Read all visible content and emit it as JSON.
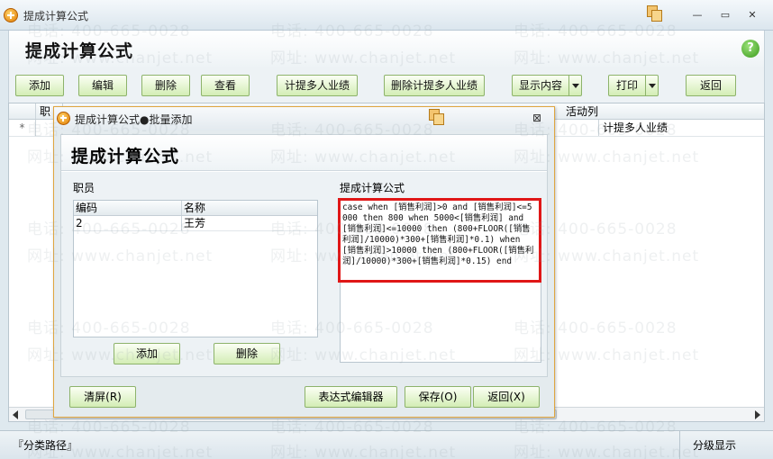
{
  "window": {
    "title": "提成计算公式"
  },
  "window_controls": {
    "minimize": "—",
    "restore": "▭",
    "close": "✕"
  },
  "page": {
    "title": "提成计算公式",
    "help": "?"
  },
  "toolbar": {
    "add": "添加",
    "edit": "编辑",
    "delete": "删除",
    "view": "查看",
    "calc_multi": "计提多人业绩",
    "delete_calc_multi": "删除计提多人业绩",
    "display": "显示内容",
    "print": "打印",
    "back": "返回"
  },
  "grid": {
    "columns": [
      "",
      "职",
      "活动列"
    ],
    "row": {
      "marker": "*",
      "value": "计提多人业绩"
    }
  },
  "statusbar": {
    "path": "『分类路径』",
    "level_display": "分级显示"
  },
  "dialog": {
    "title": "提成计算公式●批量添加",
    "close": "⊠",
    "heading": "提成计算公式",
    "staff_label": "职员",
    "formula_label": "提成计算公式",
    "staff_columns": [
      "编码",
      "名称"
    ],
    "staff_rows": [
      {
        "code": "2",
        "name": "王芳"
      }
    ],
    "formula": "case when [销售利润]>0 and [销售利润]<=5000 then 800 when 5000<[销售利润] and [销售利润]<=10000 then (800+FLOOR([销售利润]/10000)*300+[销售利润]*0.1) when [销售利润]>10000 then (800+FLOOR([销售利润]/10000)*300+[销售利润]*0.15) end",
    "add_button": "添加",
    "delete_button": "删除",
    "clear_button": "清屏(R)",
    "expr_editor_button": "表达式编辑器",
    "save_button": "保存(O)",
    "back_button": "返回(X)"
  },
  "watermark": {
    "phone": "电话: 400-665-0028",
    "site": "网址: www.chanjet.net"
  }
}
